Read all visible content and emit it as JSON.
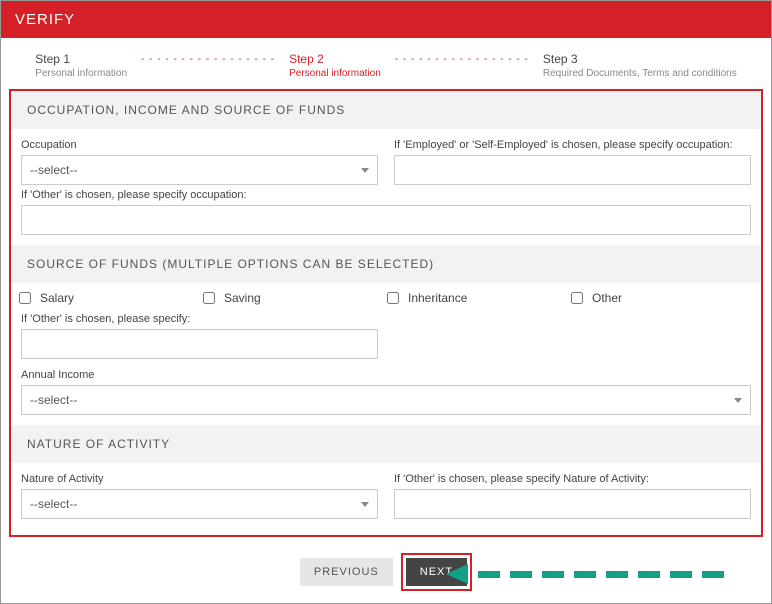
{
  "banner": {
    "title": "VERIFY"
  },
  "steps": {
    "s1": {
      "title": "Step 1",
      "sub": "Personal information"
    },
    "s2": {
      "title": "Step 2",
      "sub": "Personal information"
    },
    "s3": {
      "title": "Step 3",
      "sub": "Required Documents, Terms and conditions"
    },
    "dashes": "- - - - - - - - - - - - - - - - -"
  },
  "occupation": {
    "heading": "OCCUPATION, INCOME AND SOURCE OF FUNDS",
    "occ_label": "Occupation",
    "occ_value": "--select--",
    "emp_label": "If 'Employed' or 'Self-Employed' is chosen, please specify occupation:",
    "emp_value": "",
    "other_label": "If 'Other' is chosen, please specify occupation:",
    "other_value": ""
  },
  "funds": {
    "heading": "SOURCE OF FUNDS (MULTIPLE OPTIONS CAN BE SELECTED)",
    "opts": {
      "salary": "Salary",
      "saving": "Saving",
      "inherit": "Inheritance",
      "other": "Other"
    },
    "other_label": "If 'Other' is chosen, please specify:",
    "other_value": "",
    "income_label": "Annual Income",
    "income_value": "--select--"
  },
  "activity": {
    "heading": "NATURE OF ACTIVITY",
    "nat_label": "Nature of Activity",
    "nat_value": "--select--",
    "other_label": "If 'Other' is chosen, please specify Nature of Activity:",
    "other_value": ""
  },
  "buttons": {
    "prev": "PREVIOUS",
    "next": "NEXT"
  }
}
